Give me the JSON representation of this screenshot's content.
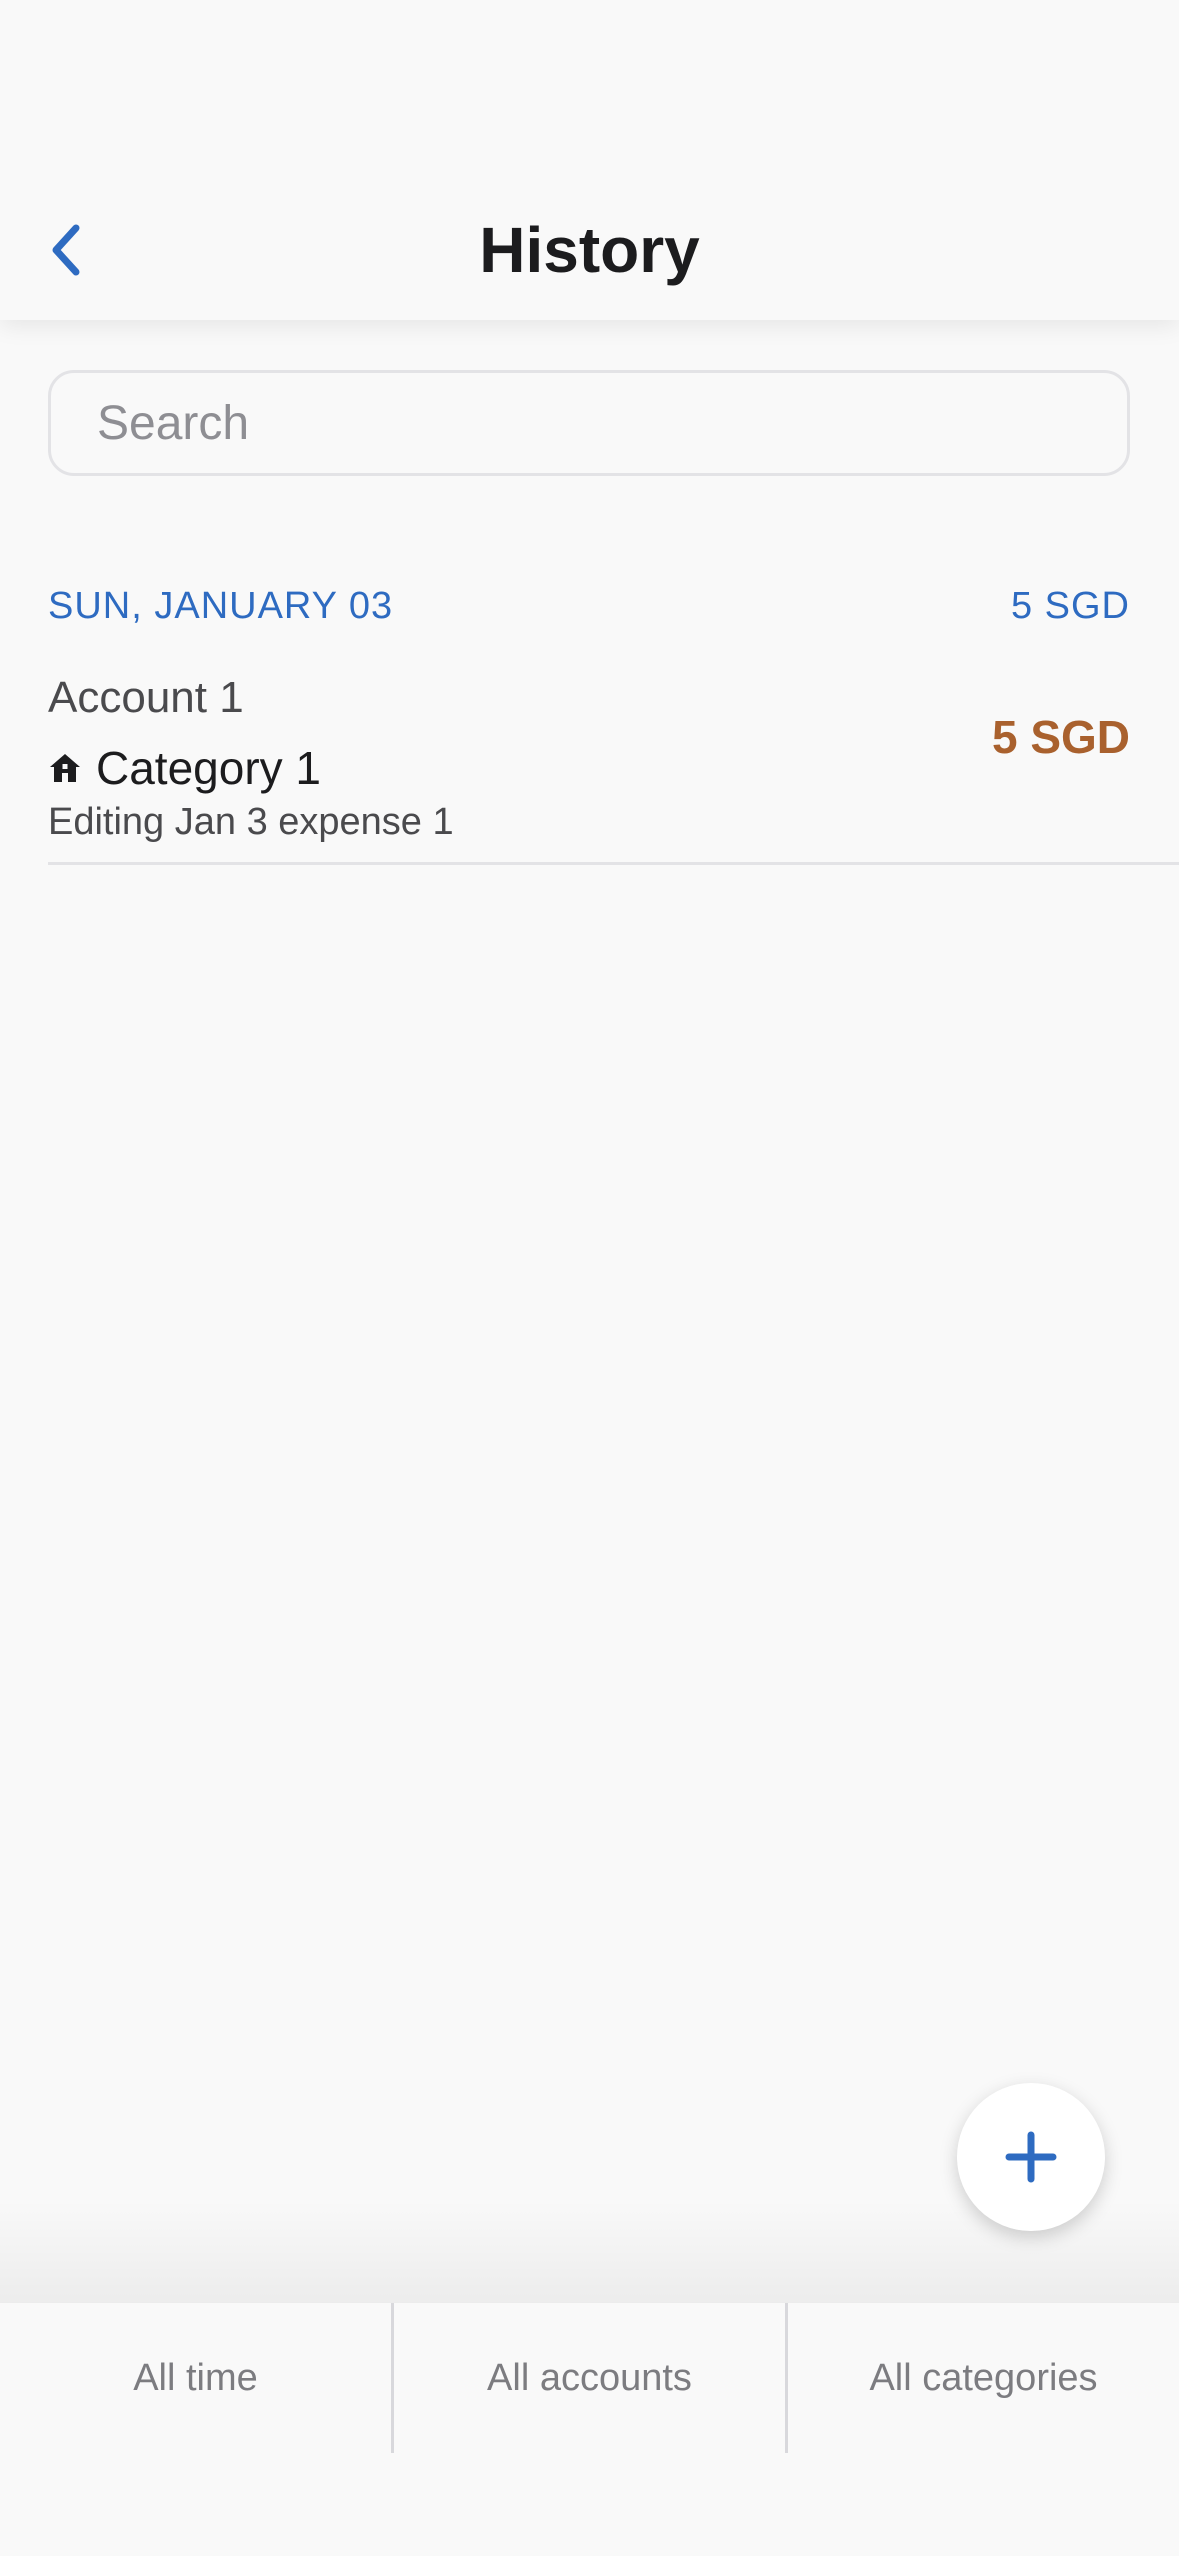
{
  "header": {
    "title": "History",
    "back_icon": "chevron-left-icon",
    "accent_color": "#2e6bc1"
  },
  "search": {
    "placeholder": "Search",
    "value": ""
  },
  "groups": [
    {
      "date": "SUN, JANUARY 03",
      "total": "5 SGD",
      "transactions": [
        {
          "account": "Account 1",
          "category_icon": "house-icon",
          "category": "Category 1",
          "note": "Editing Jan 3 expense 1",
          "amount": "5 SGD",
          "amount_color": "#a9612e"
        }
      ]
    }
  ],
  "fab": {
    "icon": "plus-icon"
  },
  "filters": {
    "time": "All time",
    "accounts": "All accounts",
    "categories": "All categories"
  }
}
